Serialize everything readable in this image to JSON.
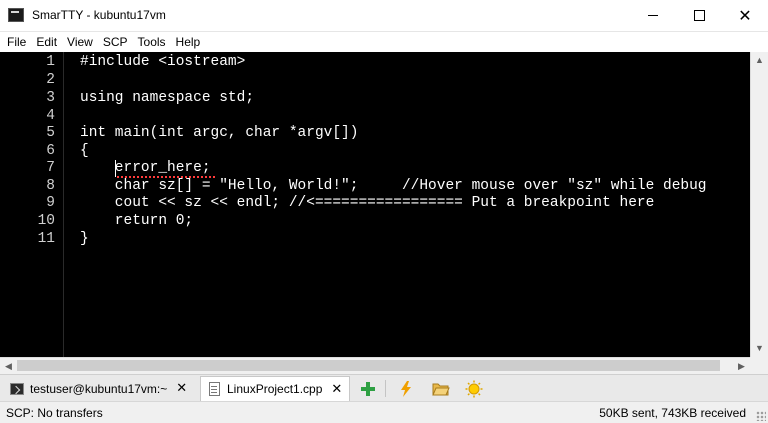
{
  "window": {
    "title": "SmarTTY - kubuntu17vm",
    "icon": "terminal-app-icon"
  },
  "menu": [
    "File",
    "Edit",
    "View",
    "SCP",
    "Tools",
    "Help"
  ],
  "editor": {
    "line_numbers": [
      "1",
      "2",
      "3",
      "4",
      "5",
      "6",
      "7",
      "8",
      "9",
      "10",
      "11"
    ],
    "lines": [
      "#include <iostream>",
      "",
      "using namespace std;",
      "",
      "int main(int argc, char *argv[])",
      "{",
      "    error_here;",
      "    char sz[] = \"Hello, World!\";     //Hover mouse over \"sz\" while debug",
      "    cout << sz << endl; //<================= Put a breakpoint here",
      "    return 0;",
      "}"
    ]
  },
  "tabs": [
    {
      "label": "testuser@kubuntu17vm:~",
      "icon": "terminal-icon",
      "active": false
    },
    {
      "label": "LinuxProject1.cpp",
      "icon": "file-icon",
      "active": true
    }
  ],
  "toolbar_icons": [
    "add-icon",
    "flash-icon",
    "folder-icon",
    "sun-icon"
  ],
  "status": {
    "left": "SCP: No transfers",
    "right": "50KB sent, 743KB received"
  },
  "colors": {
    "editor_bg": "#000000",
    "editor_text": "#ffffff",
    "add_green": "#2ea043",
    "flash_orange": "#f0a000",
    "folder_yellow": "#e8b84a",
    "sun_yellow": "#ffcc00"
  }
}
